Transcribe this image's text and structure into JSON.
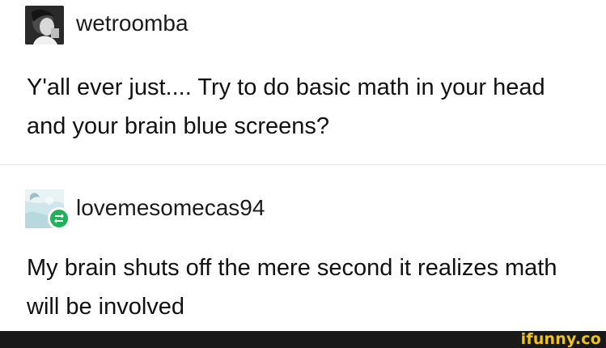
{
  "posts": [
    {
      "username": "wetroomba",
      "text": "Y'all ever just.... Try to do basic math in your head and your brain blue screens?"
    },
    {
      "username": "lovemesomecas94",
      "text": "My brain shuts off the mere second it realizes math will be involved"
    }
  ],
  "colors": {
    "reblog_badge": "#1fb25a",
    "footer_bar": "#191919",
    "watermark": "#f0c31a"
  },
  "watermark": "ifunny.co"
}
